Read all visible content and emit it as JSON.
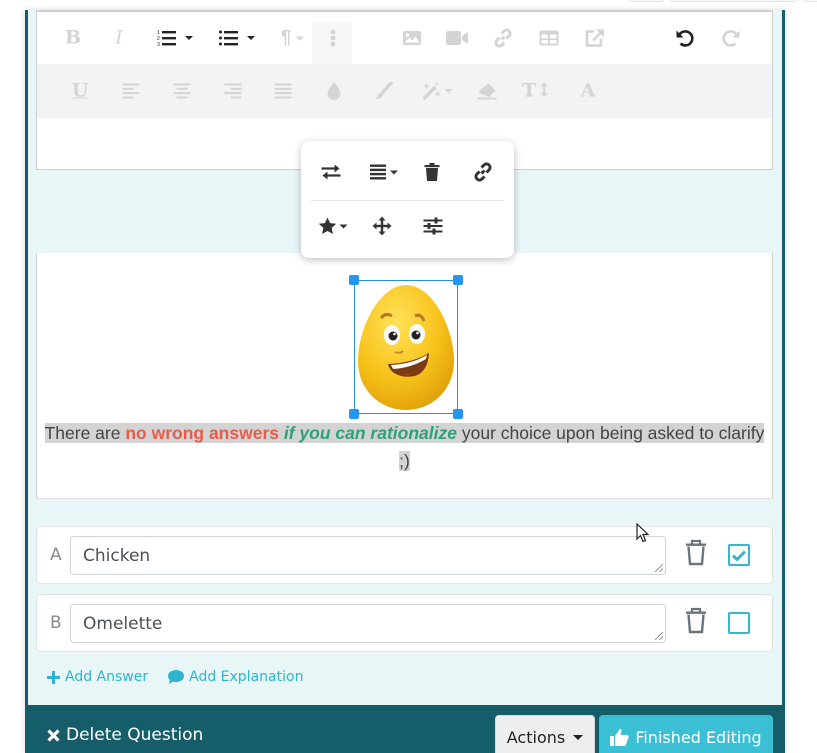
{
  "editor": {
    "toolbar_row1": [
      {
        "name": "bold",
        "label": "B",
        "active": false
      },
      {
        "name": "italic",
        "label": "I",
        "active": false
      },
      {
        "name": "ordered-list",
        "active": true,
        "dropdown": true
      },
      {
        "name": "unordered-list",
        "active": true,
        "dropdown": true
      },
      {
        "name": "paragraph-format",
        "label": "¶",
        "active": false,
        "dropdown": true
      },
      {
        "name": "more-options",
        "active": false
      },
      {
        "name": "insert-image",
        "active": false
      },
      {
        "name": "insert-video",
        "active": false
      },
      {
        "name": "insert-link",
        "active": false
      },
      {
        "name": "insert-table",
        "active": false
      },
      {
        "name": "embed-external",
        "active": false
      },
      {
        "name": "undo",
        "active": true
      },
      {
        "name": "redo",
        "active": false
      }
    ],
    "toolbar_row2": [
      {
        "name": "underline",
        "label": "U"
      },
      {
        "name": "align-left"
      },
      {
        "name": "align-center"
      },
      {
        "name": "align-right"
      },
      {
        "name": "align-justify"
      },
      {
        "name": "text-color"
      },
      {
        "name": "paint-brush"
      },
      {
        "name": "magic-wand",
        "dropdown": true
      },
      {
        "name": "clear-formatting"
      },
      {
        "name": "font-size",
        "label": "T↕"
      },
      {
        "name": "font-family",
        "label": "A"
      }
    ]
  },
  "image_popover": {
    "row1": [
      "replace-image",
      "image-align",
      "remove-image",
      "image-link"
    ],
    "row2": [
      "image-style",
      "image-move",
      "image-settings"
    ]
  },
  "explanation": {
    "part1": "There are ",
    "red": "no wrong answers",
    "part2": " ",
    "green": "if you can rationalize",
    "part3": " your choice upon being asked to clarify ;)",
    "colors": {
      "red": "#e85d4a",
      "green": "#2aa37a",
      "highlight": "#d3d3d3"
    }
  },
  "answers": [
    {
      "letter": "A",
      "value": "Chicken",
      "correct": true
    },
    {
      "letter": "B",
      "value": "Omelette",
      "correct": false
    }
  ],
  "links": {
    "add_answer": "Add Answer",
    "add_explanation": "Add Explanation"
  },
  "footer": {
    "delete_label": "Delete Question",
    "actions_label": "Actions",
    "finished_label": "Finished Editing"
  },
  "colors": {
    "teal_dark": "#155e69",
    "accent": "#3abfd4",
    "card_bg": "#e8f6f8",
    "selection": "#2196f3"
  }
}
